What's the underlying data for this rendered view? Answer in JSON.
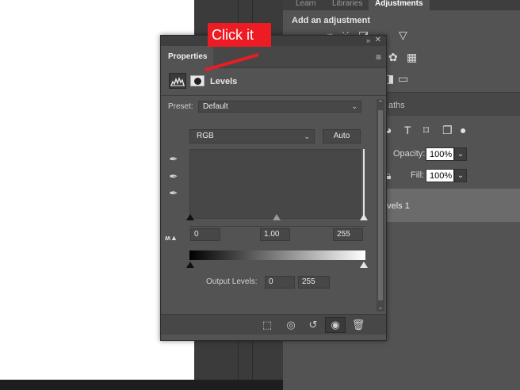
{
  "background": {
    "canvas_color": "#ffffff",
    "panel_color": "#535353"
  },
  "right_panel": {
    "tabs": [
      "Learn",
      "Libraries",
      "Adjustments"
    ],
    "active_tab": "Adjustments",
    "add_adjustment_label": "Add an adjustment",
    "paths_tab_label": "aths",
    "opacity_label": "Opacity:",
    "opacity_value": "100%",
    "fill_label": "Fill:",
    "fill_value": "100%",
    "layer_name": "evels 1"
  },
  "properties_panel": {
    "tab_label": "Properties",
    "adjustment_title": "Levels",
    "preset_label": "Preset:",
    "preset_value": "Default",
    "channel_value": "RGB",
    "auto_button_label": "Auto",
    "input_levels": {
      "black": "0",
      "midtone": "1.00",
      "white": "255"
    },
    "output_levels_label": "Output Levels:",
    "output_levels": {
      "black": "0",
      "white": "255"
    },
    "clip_warning_icon": "warning-icon"
  },
  "annotation": {
    "callout_text": "Click it",
    "color": "#ed1c24"
  }
}
